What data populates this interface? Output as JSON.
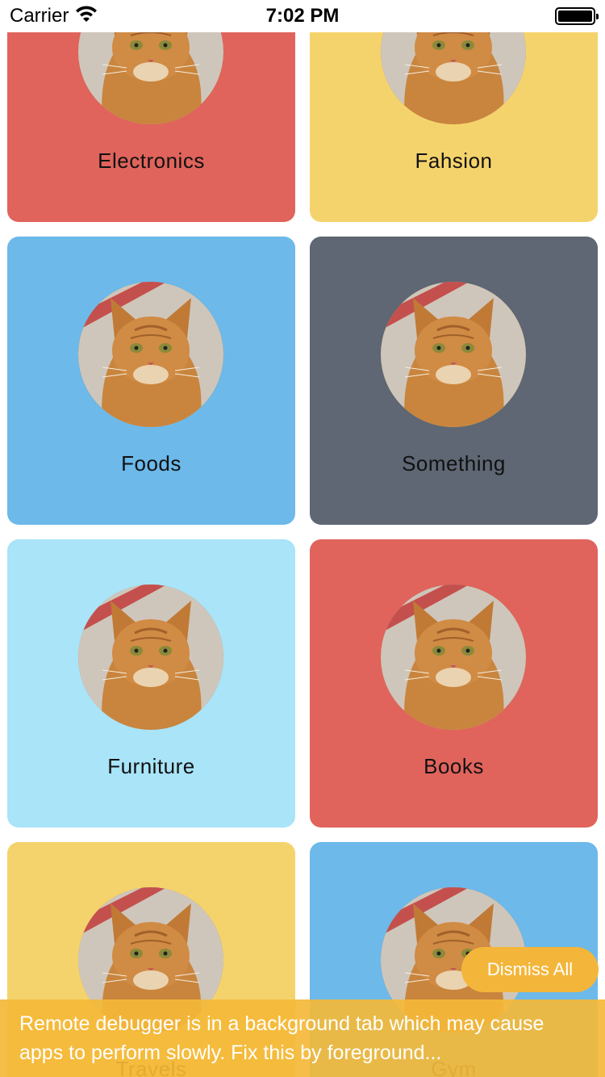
{
  "status_bar": {
    "carrier": "Carrier",
    "time": "7:02 PM"
  },
  "categories": [
    {
      "label": "Electronics",
      "color": "#e0645c"
    },
    {
      "label": "Fahsion",
      "color": "#f5d36c"
    },
    {
      "label": "Foods",
      "color": "#6cb9ea"
    },
    {
      "label": "Something",
      "color": "#5e6773"
    },
    {
      "label": "Furniture",
      "color": "#a9e4f8"
    },
    {
      "label": "Books",
      "color": "#e0645c"
    },
    {
      "label": "Travels",
      "color": "#f5d36c"
    },
    {
      "label": "Gym",
      "color": "#6cb9ea"
    }
  ],
  "dismiss_label": "Dismiss All",
  "warning_text": "Remote debugger is in a background tab which may cause apps to perform slowly. Fix this by foreground..."
}
